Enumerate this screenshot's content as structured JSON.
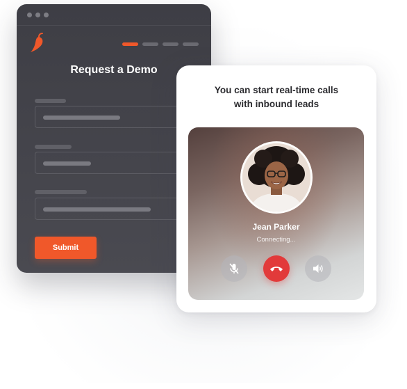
{
  "form": {
    "title": "Request a Demo",
    "submit_label": "Submit",
    "accent": "#f0582a",
    "logo_icon": "chili-pepper-logo",
    "progress": {
      "total_steps": 4,
      "current_step": 1
    }
  },
  "call": {
    "heading_line1": "You can start real-time calls",
    "heading_line2": "with inbound leads",
    "caller_name": "Jean Parker",
    "status": "Connecting...",
    "buttons": {
      "mute_icon": "microphone-off-icon",
      "hangup_icon": "phone-hangup-icon",
      "speaker_icon": "speaker-icon"
    },
    "hangup_color": "#e23a3a"
  }
}
